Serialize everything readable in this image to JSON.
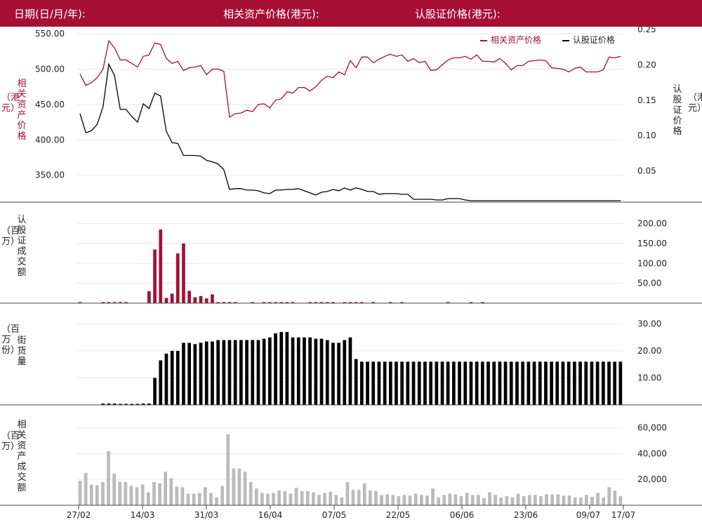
{
  "header": {
    "date_label": "日期(日/月/年):",
    "underlying_label": "相关资产价格(港元):",
    "warrant_label": "认股证价格(港元):"
  },
  "legend": {
    "underlying": "相关资产价格",
    "warrant": "认股证价格"
  },
  "colors": {
    "underlying": "#a50f34",
    "warrant": "#000000",
    "turnover_warrant": "#a50f34",
    "outstanding": "#000000",
    "turnover_underlying": "#bbbbbb",
    "header_bg": "#a50f34"
  },
  "axis_titles": {
    "price_left": "相关资产价格",
    "price_left_unit": "（港元）",
    "price_right": "认股证价格",
    "price_right_unit": "（港元）",
    "warrant_turnover": "认股证成交额",
    "warrant_turnover_unit": "（百万）",
    "outstanding": "街货量",
    "outstanding_unit": "（百万份）",
    "underlying_turnover": "相关资产成交额",
    "underlying_turnover_unit": "（百万）"
  },
  "chart_data": [
    {
      "type": "line",
      "title": "",
      "x_ticks": [
        "27/02",
        "14/03",
        "31/03",
        "16/04",
        "07/05",
        "22/05",
        "06/06",
        "23/06",
        "09/07",
        "17/07"
      ],
      "y_left_ticks": [
        "350.00",
        "400.00",
        "450.00",
        "500.00",
        "550.00"
      ],
      "y_right_ticks": [
        "0.05",
        "0.10",
        "0.15",
        "0.20",
        "0.25"
      ],
      "y_left_range": [
        312,
        560
      ],
      "y_right_range": [
        0.006,
        0.254
      ],
      "series": [
        {
          "name": "相关资产价格",
          "axis": "left",
          "values": [
            493,
            477,
            481,
            488,
            500,
            540,
            530,
            513,
            513,
            508,
            503,
            518,
            520,
            537,
            535,
            515,
            508,
            511,
            498,
            502,
            503,
            505,
            492,
            500,
            500,
            497,
            432,
            437,
            438,
            442,
            440,
            450,
            451,
            445,
            456,
            458,
            468,
            466,
            474,
            474,
            469,
            475,
            484,
            490,
            488,
            496,
            492,
            512,
            502,
            517,
            517,
            509,
            514,
            518,
            521,
            518,
            520,
            511,
            515,
            509,
            511,
            498,
            499,
            506,
            513,
            516,
            516,
            518,
            514,
            520,
            511,
            511,
            510,
            515,
            508,
            499,
            505,
            505,
            511,
            512,
            513,
            512,
            502,
            501,
            500,
            496,
            501,
            503,
            496,
            496,
            496,
            499,
            517,
            516,
            518
          ]
        },
        {
          "name": "认股证价格",
          "axis": "right",
          "values": [
            0.131,
            0.104,
            0.107,
            0.116,
            0.141,
            0.201,
            0.185,
            0.137,
            0.137,
            0.127,
            0.119,
            0.145,
            0.138,
            0.16,
            0.156,
            0.106,
            0.09,
            0.089,
            0.072,
            0.072,
            0.072,
            0.071,
            0.065,
            0.063,
            0.06,
            0.052,
            0.024,
            0.025,
            0.025,
            0.023,
            0.023,
            0.022,
            0.019,
            0.018,
            0.023,
            0.023,
            0.024,
            0.024,
            0.025,
            0.022,
            0.019,
            0.016,
            0.02,
            0.021,
            0.024,
            0.022,
            0.026,
            0.023,
            0.026,
            0.024,
            0.021,
            0.021,
            0.017,
            0.018,
            0.018,
            0.018,
            0.017,
            0.017,
            0.01,
            0.01,
            0.01,
            0.01,
            0.009,
            0.009,
            0.011,
            0.011,
            0.011,
            0.009,
            0.008,
            0.008,
            0.008,
            0.008,
            0.008,
            0.008,
            0.008,
            0.008,
            0.008,
            0.008,
            0.008,
            0.008,
            0.008,
            0.008,
            0.008,
            0.008,
            0.008,
            0.008,
            0.008,
            0.008,
            0.008,
            0.008,
            0.008,
            0.008,
            0.008,
            0.008,
            0.008
          ]
        }
      ]
    },
    {
      "type": "bar",
      "title": "",
      "ylabel": "认股证成交额（百万）",
      "y_ticks": [
        "50.00",
        "100.00",
        "150.00",
        "200.00"
      ],
      "ylim": [
        0,
        224
      ],
      "values": [
        2,
        0,
        0,
        0,
        1,
        1,
        1,
        1,
        1,
        0,
        0,
        0,
        30,
        135,
        185,
        13,
        24,
        125,
        150,
        31,
        15,
        18,
        12,
        22,
        1,
        1,
        1,
        1,
        0,
        0,
        1,
        0,
        1,
        1,
        1,
        1,
        1,
        1,
        0,
        0,
        1,
        1,
        1,
        1,
        1,
        0,
        1,
        1,
        1,
        1,
        0,
        1,
        0,
        0,
        1,
        0,
        1,
        0,
        0,
        0,
        0,
        0,
        0,
        0,
        1,
        0,
        0,
        0,
        1,
        0,
        1,
        0,
        0,
        0,
        0,
        0,
        0,
        0,
        0,
        0,
        0,
        0,
        0,
        0,
        0,
        0,
        0,
        0,
        0,
        0,
        0,
        0,
        0,
        0,
        0
      ]
    },
    {
      "type": "bar",
      "title": "",
      "ylabel": "街货量（百万份）",
      "y_ticks": [
        "10.00",
        "20.00",
        "30.00"
      ],
      "ylim": [
        0,
        33
      ],
      "values": [
        0,
        0,
        0,
        0,
        0.5,
        0.5,
        0.5,
        0.3,
        0.3,
        0.3,
        0.3,
        0.5,
        0.5,
        10,
        16.5,
        19,
        20,
        20,
        23,
        23,
        22.5,
        23,
        23.5,
        23.5,
        24,
        24,
        24,
        24,
        24,
        24,
        24,
        24,
        24.5,
        25,
        26.5,
        27,
        27,
        25,
        25,
        25,
        25,
        24.5,
        24.5,
        24,
        23,
        23,
        24,
        25,
        17,
        16,
        16,
        16,
        16,
        16,
        16,
        16,
        16,
        16,
        16,
        16,
        16,
        16,
        16,
        16,
        16,
        16,
        16,
        16,
        16,
        16,
        16,
        16,
        16,
        16,
        16,
        16,
        16,
        16,
        16,
        16,
        16,
        16,
        16,
        16,
        16,
        16,
        16,
        16,
        16,
        16,
        16,
        16,
        16,
        16,
        16
      ]
    },
    {
      "type": "bar",
      "title": "",
      "ylabel": "相关资产成交额（百万）",
      "y_ticks": [
        "20,000",
        "40,000",
        "60,000"
      ],
      "ylim": [
        0,
        68000
      ],
      "values": [
        19000,
        25000,
        16000,
        15500,
        18000,
        42000,
        24500,
        18000,
        18000,
        15000,
        14000,
        16000,
        10000,
        18000,
        17000,
        26000,
        21000,
        14500,
        14000,
        9000,
        9000,
        9500,
        14000,
        9500,
        6000,
        15000,
        55000,
        28500,
        28500,
        26000,
        18000,
        13000,
        9500,
        9000,
        9500,
        11500,
        11000,
        9000,
        13500,
        11000,
        11000,
        10000,
        8000,
        9500,
        10500,
        8000,
        6000,
        18000,
        12000,
        12000,
        17000,
        11500,
        11000,
        8000,
        8500,
        8000,
        7000,
        8000,
        7500,
        9000,
        8000,
        7500,
        13000,
        6000,
        8000,
        9000,
        8500,
        7000,
        9500,
        8000,
        8000,
        5500,
        10000,
        8000,
        6000,
        7000,
        6000,
        9000,
        7000,
        8000,
        8000,
        7000,
        8500,
        8500,
        8500,
        7500,
        7500,
        6000,
        6000,
        8000,
        6500,
        9500,
        6000,
        14000,
        11500,
        7000
      ]
    }
  ]
}
